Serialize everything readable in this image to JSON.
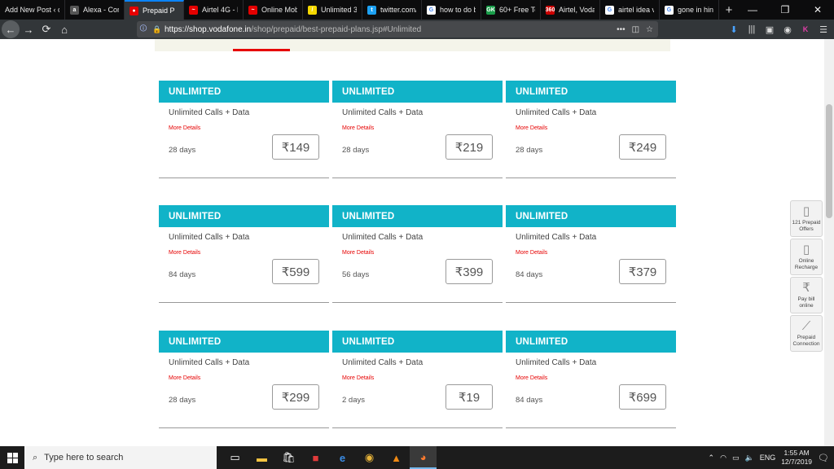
{
  "browser": {
    "tabs": [
      {
        "title": "Add New Post ‹ c",
        "favicon_color": "#0c0c0d",
        "favicon_glyph": ""
      },
      {
        "title": "Alexa - Com",
        "favicon_color": "#555",
        "favicon_glyph": "a"
      },
      {
        "title": "Prepaid P",
        "favicon_color": "#e60000",
        "favicon_glyph": "●",
        "active": true
      },
      {
        "title": "Airtel 4G - P",
        "favicon_color": "#e40000",
        "favicon_glyph": "~"
      },
      {
        "title": "Online Mob",
        "favicon_color": "#e40000",
        "favicon_glyph": "~"
      },
      {
        "title": "Unlimited 3G",
        "favicon_color": "#f5d800",
        "favicon_glyph": "/"
      },
      {
        "title": "twitter.com/",
        "favicon_color": "#1da1f2",
        "favicon_glyph": "t"
      },
      {
        "title": "how to do b",
        "favicon_color": "#ffffff",
        "favicon_glyph": "G"
      },
      {
        "title": "60+ Free Tel",
        "favicon_color": "#1a9e4a",
        "favicon_glyph": "GK"
      },
      {
        "title": "Airtel, Vodaf",
        "favicon_color": "#cc0000",
        "favicon_glyph": "360"
      },
      {
        "title": "airtel idea vo",
        "favicon_color": "#ffffff",
        "favicon_glyph": "G"
      },
      {
        "title": "gone in hind",
        "favicon_color": "#ffffff",
        "favicon_glyph": "G"
      }
    ],
    "new_tab": "+",
    "url_domain": "https://shop.vodafone.in",
    "url_path": "/shop/prepaid/best-prepaid-plans.jsp#Unlimited",
    "url_more": "•••",
    "profile_initial": "K"
  },
  "plans": [
    {
      "header": "UNLIMITED",
      "desc": "Unlimited Calls + Data",
      "more": "More Details",
      "days": "28 days",
      "price": "₹149"
    },
    {
      "header": "UNLIMITED",
      "desc": "Unlimited Calls + Data",
      "more": "More Details",
      "days": "28 days",
      "price": "₹219"
    },
    {
      "header": "UNLIMITED",
      "desc": "Unlimited Calls + Data",
      "more": "More Details",
      "days": "28 days",
      "price": "₹249"
    },
    {
      "header": "UNLIMITED",
      "desc": "Unlimited Calls + Data",
      "more": "More Details",
      "days": "84 days",
      "price": "₹599"
    },
    {
      "header": "UNLIMITED",
      "desc": "Unlimited Calls + Data",
      "more": "More Details",
      "days": "56 days",
      "price": "₹399"
    },
    {
      "header": "UNLIMITED",
      "desc": "Unlimited Calls + Data",
      "more": "More Details",
      "days": "84 days",
      "price": "₹379"
    },
    {
      "header": "UNLIMITED",
      "desc": "Unlimited Calls + Data",
      "more": "More Details",
      "days": "28 days",
      "price": "₹299"
    },
    {
      "header": "UNLIMITED",
      "desc": "Unlimited Calls + Data",
      "more": "More Details",
      "days": "2 days",
      "price": "₹19"
    },
    {
      "header": "UNLIMITED",
      "desc": "Unlimited Calls + Data",
      "more": "More Details",
      "days": "84 days",
      "price": "₹699"
    }
  ],
  "widgets": [
    {
      "label": "121 Prepaid Offers",
      "icon": "phone-icon"
    },
    {
      "label": "Online Recharge",
      "icon": "phone-icon"
    },
    {
      "label": "Pay bill online",
      "icon": "rupee-icon"
    },
    {
      "label": "Prepaid Connection",
      "icon": "pen-icon"
    }
  ],
  "taskbar": {
    "search_placeholder": "Type here to search",
    "language": "ENG",
    "time": "1:55 AM",
    "date": "12/7/2019"
  },
  "colors": {
    "accent": "#11b3c8",
    "brand": "#e60000"
  }
}
